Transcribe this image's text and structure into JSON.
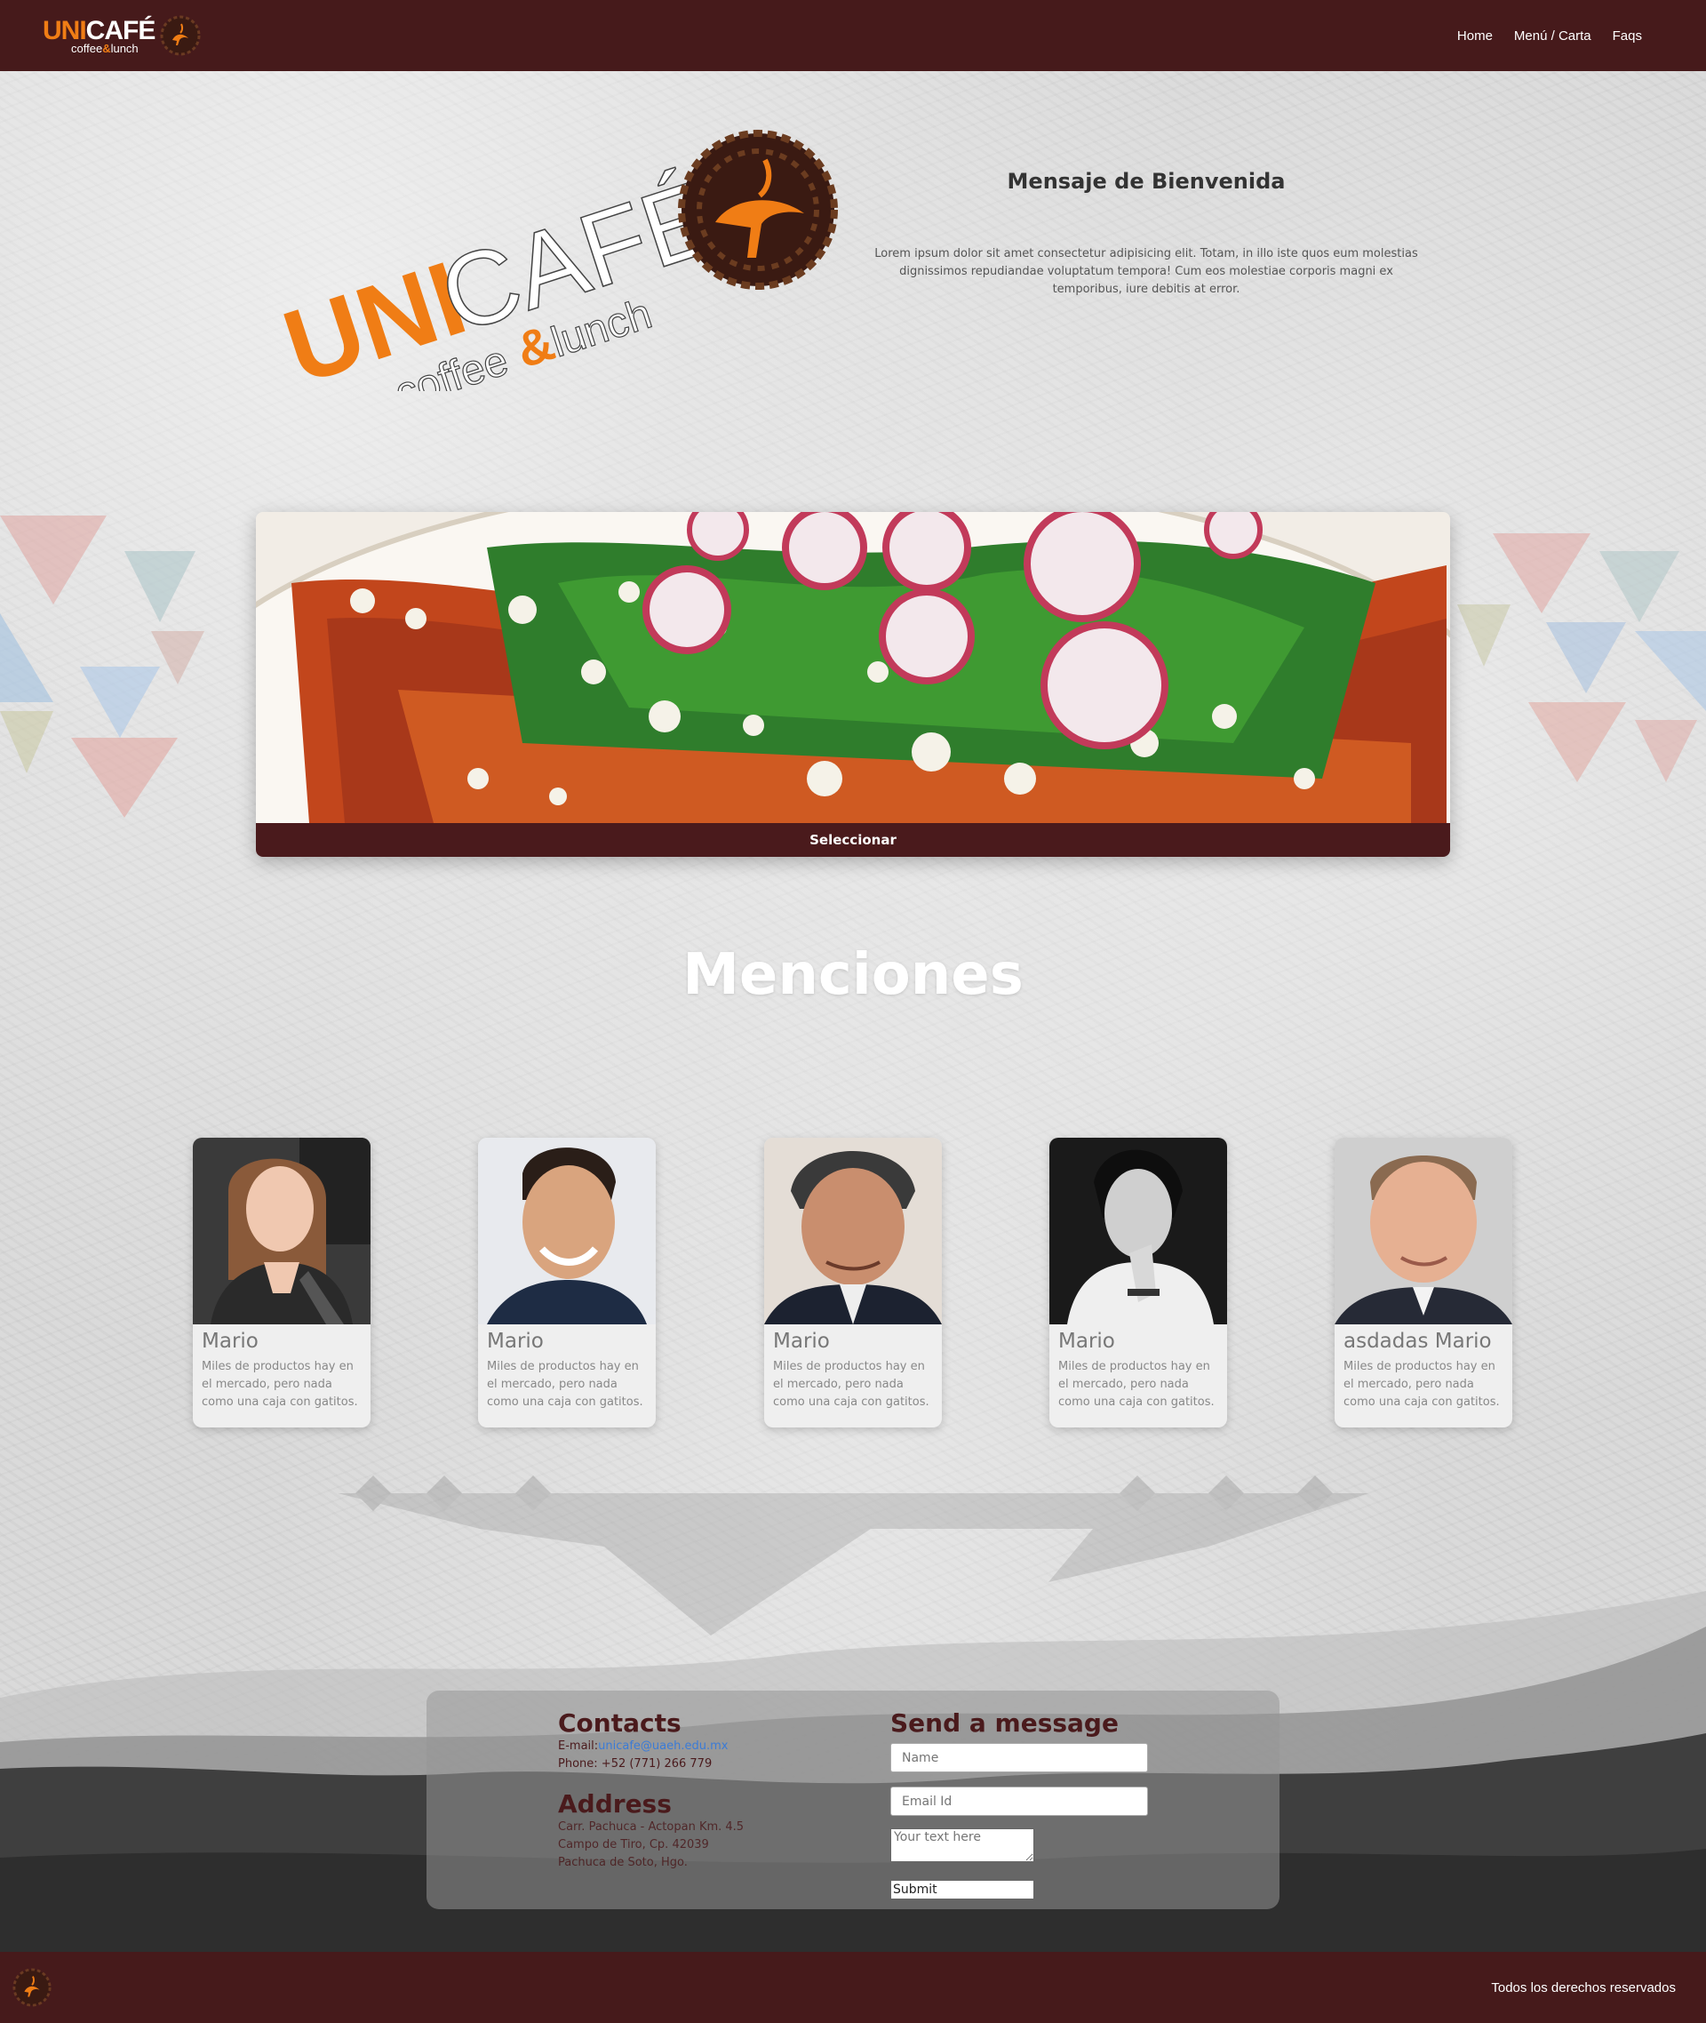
{
  "header": {
    "brand": {
      "name_part1": "UNI",
      "name_part2": "CAFÉ",
      "sub_part1": "coffee",
      "sub_amp": "&",
      "sub_part2": "lunch"
    },
    "nav": [
      {
        "label": "Home"
      },
      {
        "label": "Menú / Carta"
      },
      {
        "label": "Faqs"
      }
    ]
  },
  "hero": {
    "logo": {
      "name_part1": "UNI",
      "name_part2": "CAFÉ",
      "sub_part1": "coffee",
      "sub_amp": "&",
      "sub_part2": "lunch"
    },
    "welcome_title": "Mensaje de Bienvenida",
    "welcome_text": "Lorem ipsum dolor sit amet consectetur adipisicing elit. Totam, in illo iste quos eum molestias dignissimos repudiandae voluptatum tempora! Cum eos molestiae corporis magni ex temporibus, iure debitis at error."
  },
  "feature": {
    "button_label": "Seleccionar"
  },
  "mentions": {
    "title": "Menciones",
    "people": [
      {
        "name": "Mario",
        "description": "Miles de productos hay en el mercado, pero nada como una caja con gatitos."
      },
      {
        "name": "Mario",
        "description": "Miles de productos hay en el mercado, pero nada como una caja con gatitos."
      },
      {
        "name": "Mario",
        "description": "Miles de productos hay en el mercado, pero nada como una caja con gatitos."
      },
      {
        "name": "Mario",
        "description": "Miles de productos hay en el mercado, pero nada como una caja con gatitos."
      },
      {
        "name": "asdadas Mario",
        "description": "Miles de productos hay en el mercado, pero nada como una caja con gatitos."
      }
    ]
  },
  "contact": {
    "contacts_heading": "Contacts",
    "email_label": "E-mail:",
    "email_value": "unicafe@uaeh.edu.mx",
    "phone_label": "Phone:",
    "phone_value": "+52 (771) 266 779",
    "address_heading": "Address",
    "address_lines": [
      "Carr. Pachuca - Actopan Km. 4.5",
      "Campo de Tiro, Cp. 42039",
      "Pachuca de Soto, Hgo."
    ],
    "message_heading": "Send a message",
    "name_placeholder": "Name",
    "email_placeholder": "Email Id",
    "text_placeholder": "Your text here",
    "submit_label": "Submit"
  },
  "footer": {
    "rights": "Todos los derechos reservados"
  },
  "colors": {
    "brand_dark": "#461a1b",
    "brand_orange": "#f07d15",
    "link": "#3b7bd6"
  },
  "icons": {
    "logo_emblem": "coffee-bean-bird-emblem"
  }
}
